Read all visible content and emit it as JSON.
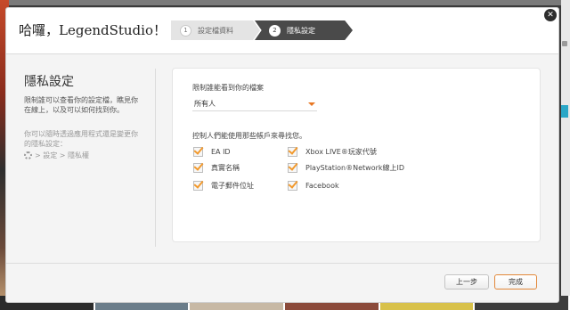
{
  "header": {
    "greeting": "哈囉，LegendStudio！",
    "steps": [
      {
        "num": "1",
        "label": "設定檔資料"
      },
      {
        "num": "2",
        "label": "隱私設定"
      }
    ],
    "close_label": "✕"
  },
  "sidebar": {
    "title": "隱私設定",
    "description": "限制誰可以查看你的設定檔，瞧見你在線上，以及可以如何找到你。",
    "hint": "你可以隨時透過應用程式還是變更你的隱私設定：",
    "path": "> 設定 > 隱私權"
  },
  "main": {
    "profile_visibility_label": "限制誰能看到你的檔案",
    "profile_visibility_value": "所有人",
    "search_label": "控制人們能使用那些帳戶來尋找您。",
    "checkboxes": [
      {
        "label": "EA ID"
      },
      {
        "label": "真實名稱"
      },
      {
        "label": "電子郵件位址"
      },
      {
        "label": "Xbox LIVE®玩家代號"
      },
      {
        "label": "PlayStation®Network線上ID"
      },
      {
        "label": "Facebook"
      }
    ]
  },
  "footer": {
    "back_label": "上一步",
    "done_label": "完成"
  },
  "colors": {
    "accent": "#f29a2e",
    "active_step": "#4a4a4a"
  }
}
